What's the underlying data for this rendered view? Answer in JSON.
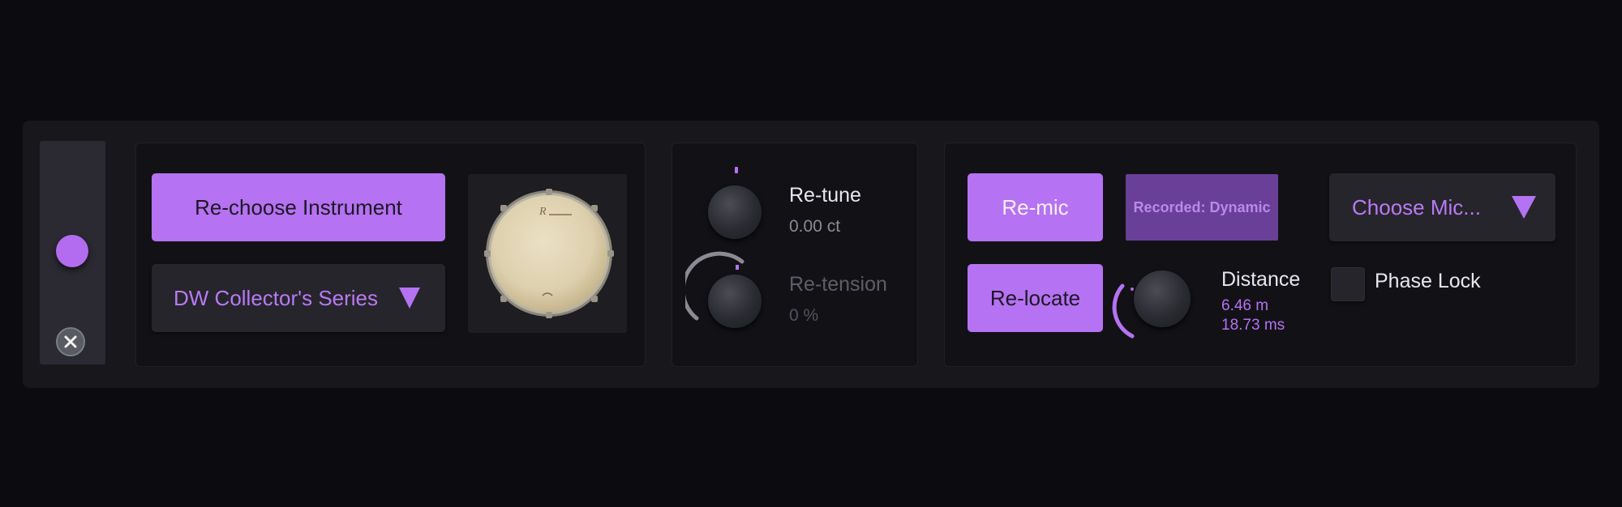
{
  "instrument_panel": {
    "choose_button_label": "Re-choose Instrument",
    "series_dropdown_label": "DW Collector's Series",
    "drum_logo_text": "R"
  },
  "tuning_panel": {
    "retune_label": "Re-tune",
    "retune_value": "0.00 ct",
    "retension_label": "Re-tension",
    "retension_value": "0 %"
  },
  "mic_panel": {
    "remic_label": "Re-mic",
    "recorded_badge": "Recorded: Dynamic",
    "choose_mic_label": "Choose Mic...",
    "relocate_label": "Re-locate",
    "distance_label": "Distance",
    "distance_meters": "6.46 m",
    "distance_ms": "18.73 ms",
    "phase_lock_label": "Phase Lock",
    "phase_lock_checked": false
  },
  "colors": {
    "accent": "#b572f2",
    "background": "#0c0c10",
    "panel": "#121216"
  },
  "icons": {
    "rail_handle": "circle-handle-icon",
    "close": "close-icon",
    "dropdown": "triangle-down-icon"
  }
}
